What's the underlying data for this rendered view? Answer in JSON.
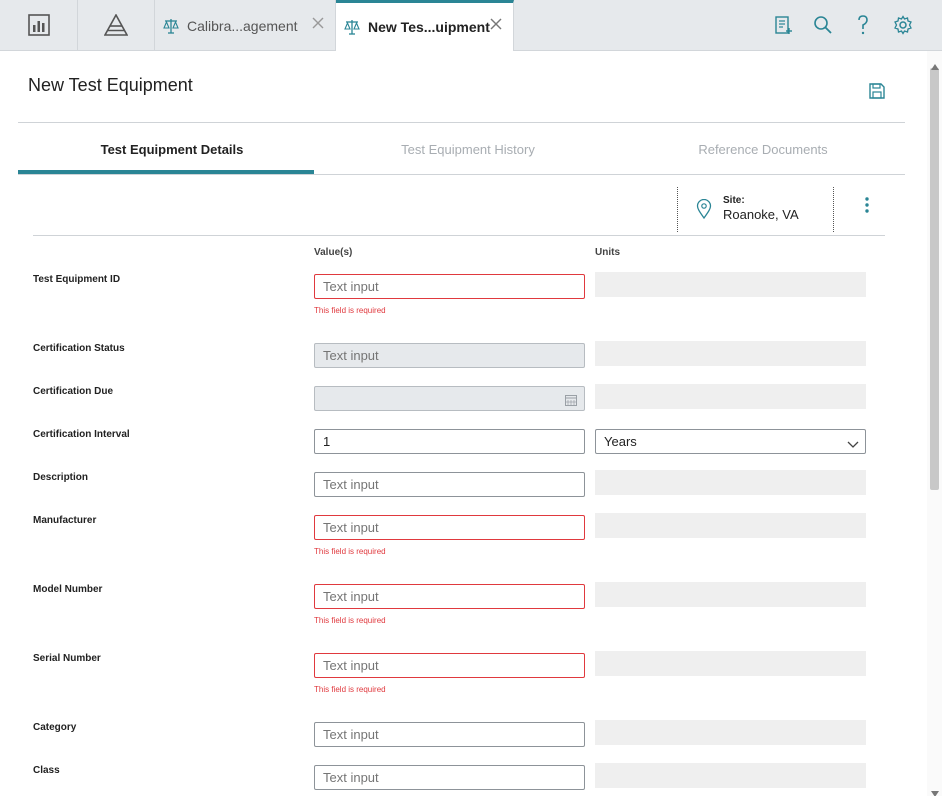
{
  "tabs": [
    {
      "label": "Calibra...agement"
    },
    {
      "label": "New Tes...uipment"
    }
  ],
  "page": {
    "title": "New Test Equipment"
  },
  "subtabs": [
    "Test Equipment Details",
    "Test Equipment History",
    "Reference Documents"
  ],
  "site": {
    "label": "Site:",
    "value": "Roanoke, VA"
  },
  "columns": {
    "values": "Value(s)",
    "units": "Units"
  },
  "fields": [
    {
      "label": "Test Equipment ID",
      "placeholder": "Text input",
      "error": "This field is required"
    },
    {
      "label": "Certification Status",
      "placeholder": "Text input"
    },
    {
      "label": "Certification Due"
    },
    {
      "label": "Certification Interval",
      "value": "1",
      "unit": "Years"
    },
    {
      "label": "Description",
      "placeholder": "Text input"
    },
    {
      "label": "Manufacturer",
      "placeholder": "Text input",
      "error": "This field is required"
    },
    {
      "label": "Model Number",
      "placeholder": "Text input",
      "error": "This field is required"
    },
    {
      "label": "Serial Number",
      "placeholder": "Text input",
      "error": "This field is required"
    },
    {
      "label": "Category",
      "placeholder": "Text input"
    },
    {
      "label": "Class",
      "placeholder": "Text input"
    }
  ],
  "colors": {
    "accent": "#2a8595",
    "error": "#e0393e",
    "tabbar": "#e6e9ec"
  },
  "icons": [
    "dashboard-icon",
    "asset-hierarchy-icon",
    "scale-icon",
    "close-icon",
    "new-record-icon",
    "search-icon",
    "help-icon",
    "settings-icon",
    "save-icon",
    "location-pin-icon",
    "kebab-menu-icon",
    "calendar-icon",
    "chevron-down-icon"
  ]
}
